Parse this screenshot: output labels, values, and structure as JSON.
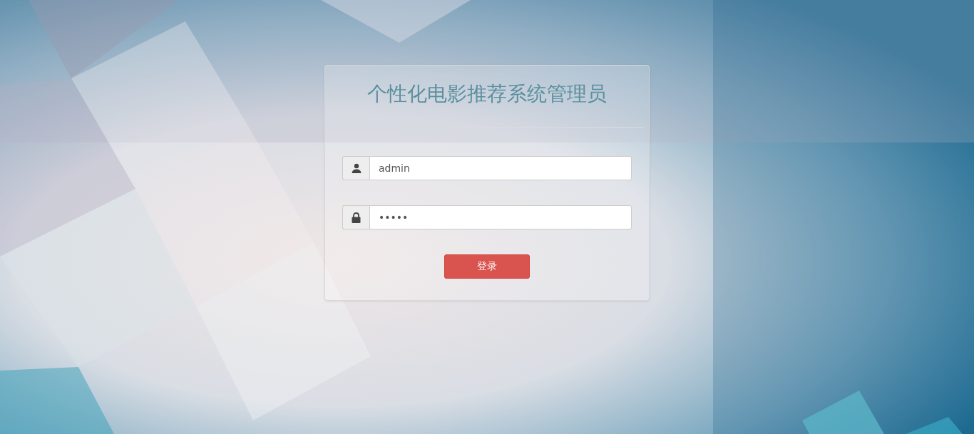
{
  "title": "个性化电影推荐系统管理员",
  "username": {
    "value": "admin"
  },
  "password": {
    "value": "•••••"
  },
  "login_button": {
    "label": "登录"
  }
}
